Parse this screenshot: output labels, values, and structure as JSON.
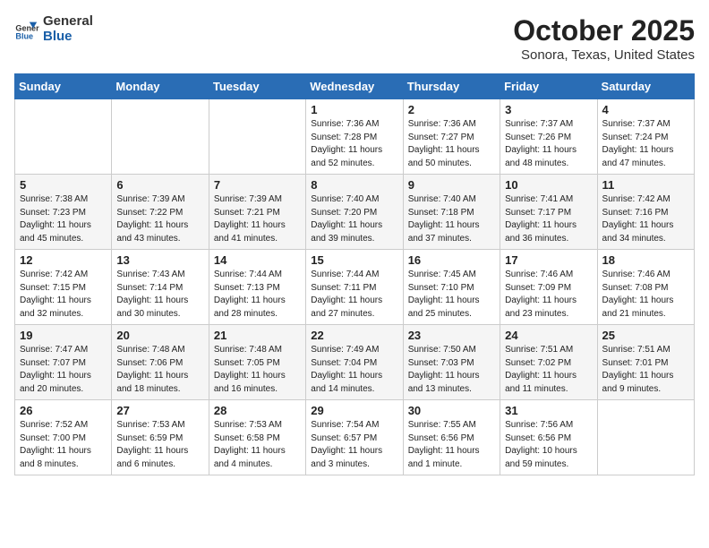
{
  "header": {
    "logo_general": "General",
    "logo_blue": "Blue",
    "month": "October 2025",
    "location": "Sonora, Texas, United States"
  },
  "weekdays": [
    "Sunday",
    "Monday",
    "Tuesday",
    "Wednesday",
    "Thursday",
    "Friday",
    "Saturday"
  ],
  "weeks": [
    [
      {
        "day": "",
        "info": ""
      },
      {
        "day": "",
        "info": ""
      },
      {
        "day": "",
        "info": ""
      },
      {
        "day": "1",
        "info": "Sunrise: 7:36 AM\nSunset: 7:28 PM\nDaylight: 11 hours\nand 52 minutes."
      },
      {
        "day": "2",
        "info": "Sunrise: 7:36 AM\nSunset: 7:27 PM\nDaylight: 11 hours\nand 50 minutes."
      },
      {
        "day": "3",
        "info": "Sunrise: 7:37 AM\nSunset: 7:26 PM\nDaylight: 11 hours\nand 48 minutes."
      },
      {
        "day": "4",
        "info": "Sunrise: 7:37 AM\nSunset: 7:24 PM\nDaylight: 11 hours\nand 47 minutes."
      }
    ],
    [
      {
        "day": "5",
        "info": "Sunrise: 7:38 AM\nSunset: 7:23 PM\nDaylight: 11 hours\nand 45 minutes."
      },
      {
        "day": "6",
        "info": "Sunrise: 7:39 AM\nSunset: 7:22 PM\nDaylight: 11 hours\nand 43 minutes."
      },
      {
        "day": "7",
        "info": "Sunrise: 7:39 AM\nSunset: 7:21 PM\nDaylight: 11 hours\nand 41 minutes."
      },
      {
        "day": "8",
        "info": "Sunrise: 7:40 AM\nSunset: 7:20 PM\nDaylight: 11 hours\nand 39 minutes."
      },
      {
        "day": "9",
        "info": "Sunrise: 7:40 AM\nSunset: 7:18 PM\nDaylight: 11 hours\nand 37 minutes."
      },
      {
        "day": "10",
        "info": "Sunrise: 7:41 AM\nSunset: 7:17 PM\nDaylight: 11 hours\nand 36 minutes."
      },
      {
        "day": "11",
        "info": "Sunrise: 7:42 AM\nSunset: 7:16 PM\nDaylight: 11 hours\nand 34 minutes."
      }
    ],
    [
      {
        "day": "12",
        "info": "Sunrise: 7:42 AM\nSunset: 7:15 PM\nDaylight: 11 hours\nand 32 minutes."
      },
      {
        "day": "13",
        "info": "Sunrise: 7:43 AM\nSunset: 7:14 PM\nDaylight: 11 hours\nand 30 minutes."
      },
      {
        "day": "14",
        "info": "Sunrise: 7:44 AM\nSunset: 7:13 PM\nDaylight: 11 hours\nand 28 minutes."
      },
      {
        "day": "15",
        "info": "Sunrise: 7:44 AM\nSunset: 7:11 PM\nDaylight: 11 hours\nand 27 minutes."
      },
      {
        "day": "16",
        "info": "Sunrise: 7:45 AM\nSunset: 7:10 PM\nDaylight: 11 hours\nand 25 minutes."
      },
      {
        "day": "17",
        "info": "Sunrise: 7:46 AM\nSunset: 7:09 PM\nDaylight: 11 hours\nand 23 minutes."
      },
      {
        "day": "18",
        "info": "Sunrise: 7:46 AM\nSunset: 7:08 PM\nDaylight: 11 hours\nand 21 minutes."
      }
    ],
    [
      {
        "day": "19",
        "info": "Sunrise: 7:47 AM\nSunset: 7:07 PM\nDaylight: 11 hours\nand 20 minutes."
      },
      {
        "day": "20",
        "info": "Sunrise: 7:48 AM\nSunset: 7:06 PM\nDaylight: 11 hours\nand 18 minutes."
      },
      {
        "day": "21",
        "info": "Sunrise: 7:48 AM\nSunset: 7:05 PM\nDaylight: 11 hours\nand 16 minutes."
      },
      {
        "day": "22",
        "info": "Sunrise: 7:49 AM\nSunset: 7:04 PM\nDaylight: 11 hours\nand 14 minutes."
      },
      {
        "day": "23",
        "info": "Sunrise: 7:50 AM\nSunset: 7:03 PM\nDaylight: 11 hours\nand 13 minutes."
      },
      {
        "day": "24",
        "info": "Sunrise: 7:51 AM\nSunset: 7:02 PM\nDaylight: 11 hours\nand 11 minutes."
      },
      {
        "day": "25",
        "info": "Sunrise: 7:51 AM\nSunset: 7:01 PM\nDaylight: 11 hours\nand 9 minutes."
      }
    ],
    [
      {
        "day": "26",
        "info": "Sunrise: 7:52 AM\nSunset: 7:00 PM\nDaylight: 11 hours\nand 8 minutes."
      },
      {
        "day": "27",
        "info": "Sunrise: 7:53 AM\nSunset: 6:59 PM\nDaylight: 11 hours\nand 6 minutes."
      },
      {
        "day": "28",
        "info": "Sunrise: 7:53 AM\nSunset: 6:58 PM\nDaylight: 11 hours\nand 4 minutes."
      },
      {
        "day": "29",
        "info": "Sunrise: 7:54 AM\nSunset: 6:57 PM\nDaylight: 11 hours\nand 3 minutes."
      },
      {
        "day": "30",
        "info": "Sunrise: 7:55 AM\nSunset: 6:56 PM\nDaylight: 11 hours\nand 1 minute."
      },
      {
        "day": "31",
        "info": "Sunrise: 7:56 AM\nSunset: 6:56 PM\nDaylight: 10 hours\nand 59 minutes."
      },
      {
        "day": "",
        "info": ""
      }
    ]
  ]
}
